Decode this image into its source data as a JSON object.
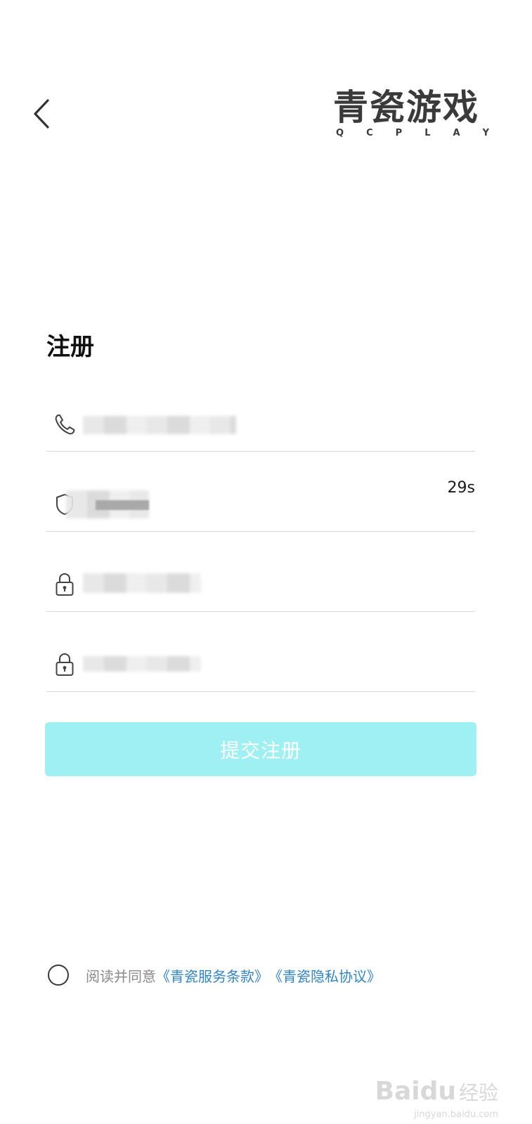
{
  "header": {
    "back_icon": "chevron-left-icon",
    "logo": {
      "title": "青瓷游戏",
      "subtitle_letters": [
        "Q",
        "C",
        "P",
        "L",
        "A",
        "Y"
      ]
    }
  },
  "page_title": "注册",
  "form": {
    "phone": {
      "icon": "phone-icon",
      "value": ""
    },
    "verify_code": {
      "icon": "shield-icon",
      "value": "",
      "countdown": "29s"
    },
    "password": {
      "icon": "lock-icon",
      "value": ""
    },
    "confirm_password": {
      "icon": "lock-icon",
      "value": ""
    },
    "submit_label": "提交注册"
  },
  "agreement": {
    "prefix": "阅读并同意",
    "terms_link": "《青瓷服务条款》",
    "privacy_link": "《青瓷隐私协议》"
  },
  "watermark": {
    "brand": "Baidu",
    "cn": "经验",
    "url": "jingyan.baidu.com"
  },
  "colors": {
    "accent_button": "#9ff0f3",
    "link": "#2f85c8",
    "muted_text": "#8a8a8a",
    "divider": "#d7d7d7"
  }
}
